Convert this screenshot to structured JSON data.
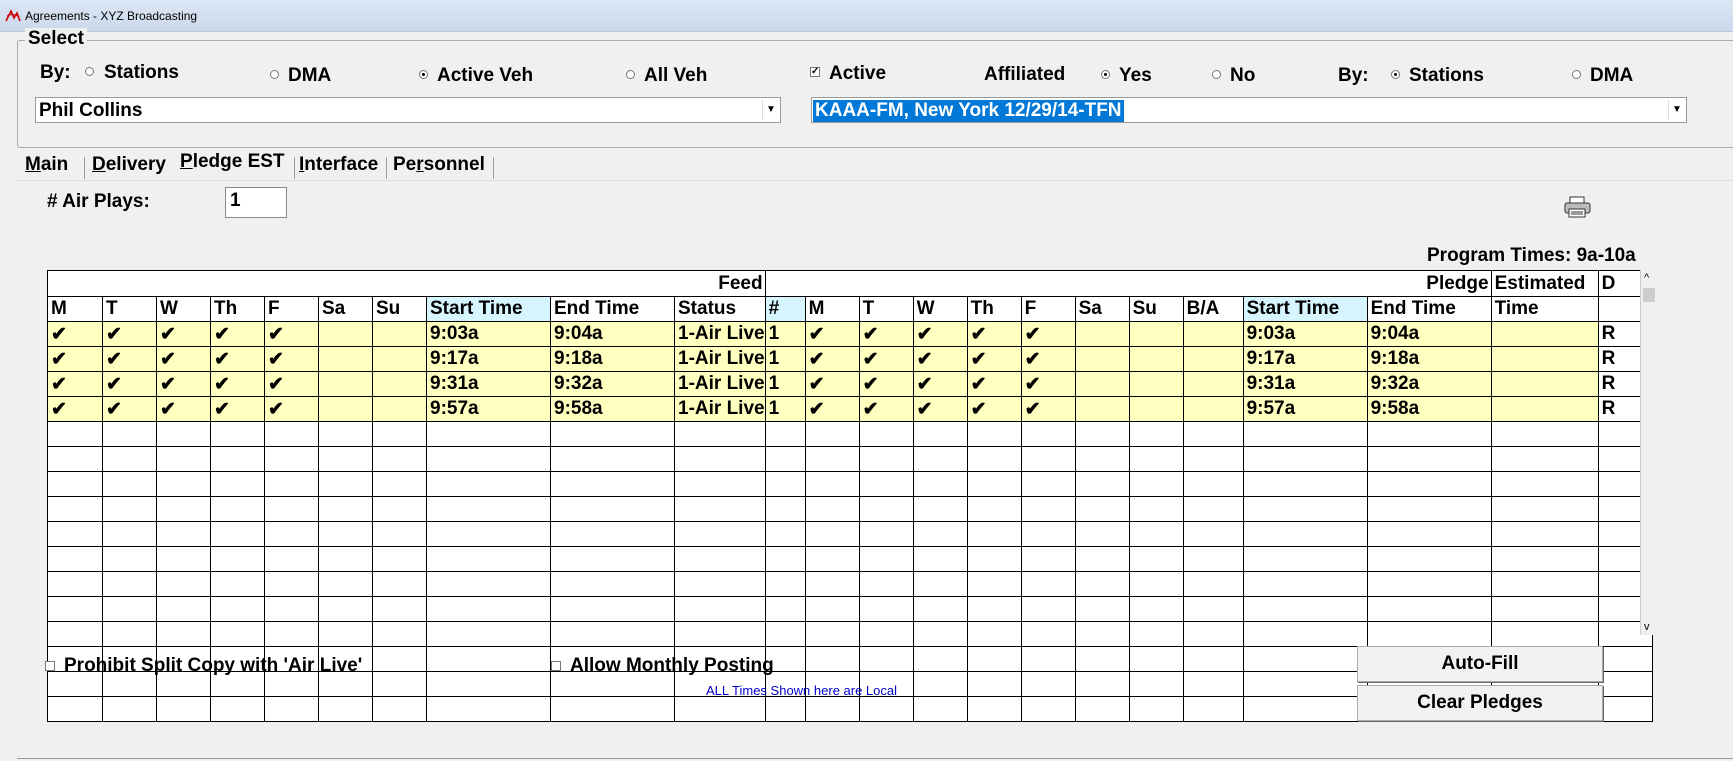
{
  "window": {
    "title": "Agreements - XYZ Broadcasting"
  },
  "select": {
    "legend": "Select",
    "by_label_left": "By:",
    "opt_stations": "Stations",
    "opt_dma": "DMA",
    "opt_active_veh": "Active Veh",
    "opt_all_veh": "All Veh",
    "active_label": "Active",
    "affiliated_label": "Affiliated",
    "opt_yes": "Yes",
    "opt_no": "No",
    "by_label_right": "By:",
    "opt_stations_right": "Stations",
    "opt_dma_right": "DMA",
    "vehicle_combo": "Phil Collins",
    "station_combo": "KAAA-FM, New York 12/29/14-TFN"
  },
  "tabs": {
    "main": {
      "pre": "",
      "key": "M",
      "post": "ain"
    },
    "delivery": {
      "pre": "",
      "key": "D",
      "post": "elivery"
    },
    "pledge": {
      "pre": "",
      "key": "P",
      "post": "ledge EST"
    },
    "interface": {
      "pre": "",
      "key": "I",
      "post": "nterface"
    },
    "personnel": {
      "pre": "Pe",
      "key": "r",
      "post": "sonnel"
    }
  },
  "form": {
    "air_plays_label": "# Air Plays:",
    "air_plays_value": "1",
    "program_times": "Program Times: 9a-10a"
  },
  "grid": {
    "feed_label": "Feed",
    "pledge_label": "Pledge",
    "estimated_label": "Estimated",
    "d_label": "D",
    "columns": [
      "M",
      "T",
      "W",
      "Th",
      "F",
      "Sa",
      "Su",
      "Start Time",
      "End Time",
      "Status",
      "#",
      "M",
      "T",
      "W",
      "Th",
      "F",
      "Sa",
      "Su",
      "B/A",
      "Start Time",
      "End Time",
      "Time",
      ""
    ],
    "rows": [
      [
        "✔",
        "✔",
        "✔",
        "✔",
        "✔",
        "",
        "",
        "9:03a",
        "9:04a",
        "1-Air Live",
        "1",
        "✔",
        "✔",
        "✔",
        "✔",
        "✔",
        "",
        "",
        "",
        "9:03a",
        "9:04a",
        "",
        "R"
      ],
      [
        "✔",
        "✔",
        "✔",
        "✔",
        "✔",
        "",
        "",
        "9:17a",
        "9:18a",
        "1-Air Live",
        "1",
        "✔",
        "✔",
        "✔",
        "✔",
        "✔",
        "",
        "",
        "",
        "9:17a",
        "9:18a",
        "",
        "R"
      ],
      [
        "✔",
        "✔",
        "✔",
        "✔",
        "✔",
        "",
        "",
        "9:31a",
        "9:32a",
        "1-Air Live",
        "1",
        "✔",
        "✔",
        "✔",
        "✔",
        "✔",
        "",
        "",
        "",
        "9:31a",
        "9:32a",
        "",
        "R"
      ],
      [
        "✔",
        "✔",
        "✔",
        "✔",
        "✔",
        "",
        "",
        "9:57a",
        "9:58a",
        "1-Air Live",
        "1",
        "✔",
        "✔",
        "✔",
        "✔",
        "✔",
        "",
        "",
        "",
        "9:57a",
        "9:58a",
        "",
        "R"
      ]
    ]
  },
  "options": {
    "prohibit_split": "Prohibit Split Copy with 'Air Live'",
    "allow_monthly": "Allow Monthly Posting",
    "times_note": "ALL Times Shown here are Local"
  },
  "buttons": {
    "auto_fill": "Auto-Fill",
    "clear_pledges": "Clear Pledges"
  }
}
